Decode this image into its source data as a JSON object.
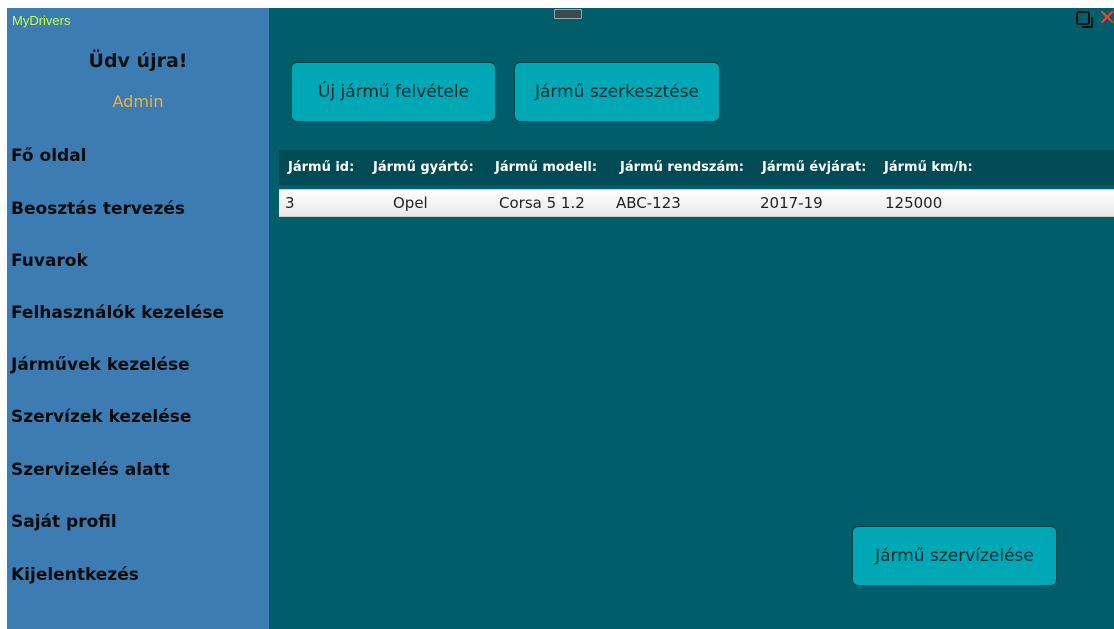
{
  "window": {
    "app_title": "MyDrivers"
  },
  "sidebar": {
    "welcome": "Üdv újra!",
    "username": "Admin",
    "items": [
      {
        "label": "Fő oldal"
      },
      {
        "label": "Beosztás tervezés"
      },
      {
        "label": "Fuvarok"
      },
      {
        "label": "Felhasználók kezelése"
      },
      {
        "label": "Járművek kezelése"
      },
      {
        "label": "Szervízek kezelése"
      },
      {
        "label": "Szervizelés alatt"
      },
      {
        "label": "Saját profil"
      },
      {
        "label": "Kijelentkezés"
      }
    ]
  },
  "toolbar": {
    "add_vehicle": "Új jármű felvétele",
    "edit_vehicle": "Jármű szerkesztése",
    "service_vehicle": "Jármű szervízelése"
  },
  "table": {
    "columns": [
      "Jármű id:",
      "Jármű gyártó:",
      "Jármű modell:",
      "Jármű rendszám:",
      "Jármű évjárat:",
      "Jármű km/h:"
    ],
    "rows": [
      [
        "3",
        "Opel",
        "Corsa 5 1.2",
        "ABC-123",
        "2017-19",
        "125000"
      ]
    ]
  },
  "colors": {
    "content_bg": "#005e6a",
    "sidebar_bg": "#3c7cb2",
    "button_bg": "#00a8b6",
    "header_bg": "#004b55",
    "app_title": "#c6ff3a",
    "username": "#f2b230",
    "close_icon": "#f04030"
  },
  "icons": {
    "restore": "restore-icon",
    "close": "close-icon",
    "drag_handle": "drag-handle-icon"
  }
}
